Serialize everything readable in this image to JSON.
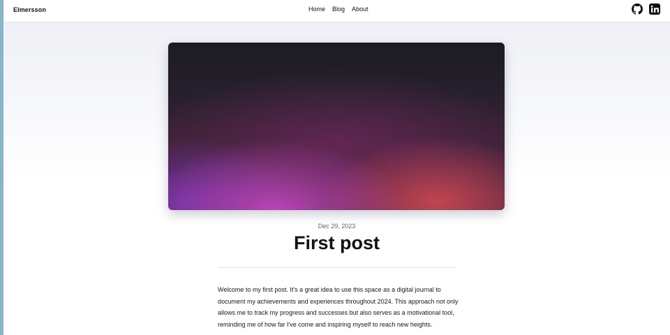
{
  "navbar": {
    "brand": "Elmersson",
    "links": [
      {
        "label": "Home"
      },
      {
        "label": "Blog"
      },
      {
        "label": "About"
      }
    ],
    "social": [
      {
        "icon": "github-icon"
      },
      {
        "icon": "linkedin-icon"
      }
    ]
  },
  "post": {
    "date": "Dec 29, 2023",
    "title": "First post",
    "body": "Welcome to my first post. It's a great idea to use this space as a digital journal to document my achievements and experiences throughout 2024. This approach not only allows me to track my progress and successes but also serves as a motivational tool, reminding me of how far I've come and inspiring myself to reach new heights."
  },
  "colors": {
    "accent_hero_top": "#1c1b22",
    "accent_hero_purple": "#be46be",
    "accent_hero_red": "#c84650",
    "left_edge": "#8ab4c8"
  }
}
